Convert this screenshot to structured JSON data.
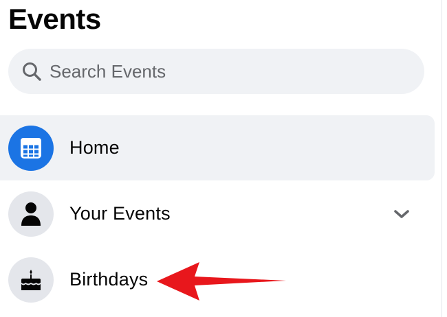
{
  "page_title": "Events",
  "search": {
    "placeholder": "Search Events",
    "icon": "search-icon"
  },
  "nav": {
    "items": [
      {
        "label": "Home",
        "icon": "calendar-grid-icon",
        "active": true
      },
      {
        "label": "Your Events",
        "icon": "person-icon",
        "active": false,
        "has_chevron": true
      },
      {
        "label": "Birthdays",
        "icon": "birthday-cake-icon",
        "active": false
      }
    ]
  },
  "annotation": {
    "arrow_color": "#e8171c",
    "points_to": "Birthdays"
  },
  "colors": {
    "accent": "#1b74e4",
    "surface": "#f0f2f5",
    "icon_bg": "#e4e6eb",
    "text": "#050505",
    "secondary_text": "#65676b"
  }
}
